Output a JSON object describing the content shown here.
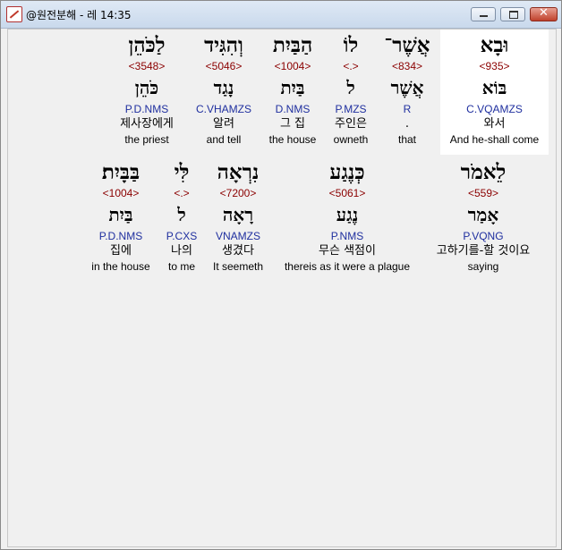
{
  "window": {
    "title": "@원전분해 - 레 14:35",
    "icon": "app-icon",
    "buttons": {
      "minimize": "minimize-icon",
      "maximize": "maximize-icon",
      "close": "✕"
    }
  },
  "colors": {
    "strong": "#8b0000",
    "morph": "#1f2f9f",
    "highlight_bg": "#ffffff"
  },
  "rows": [
    {
      "words": [
        {
          "heb": "וּבָא",
          "strong": "<935>",
          "lemma": "בּוֹא",
          "morph": "C.VQAMZS",
          "kor": "와서",
          "eng": "And he-shall come"
        },
        {
          "heb": "אֲשֶׁר־",
          "strong": "<834>",
          "lemma": "אֲשֶׁר",
          "morph": "R",
          "kor": ".",
          "eng": "that"
        },
        {
          "heb": "לוֹ",
          "strong": "<.>",
          "lemma": "ל",
          "morph": "P.MZS",
          "kor": "주인은",
          "eng": "owneth"
        },
        {
          "heb": "הַבַּיִת",
          "strong": "<1004>",
          "lemma": "בַּיִת",
          "morph": "D.NMS",
          "kor": "그 집",
          "eng": "the house"
        },
        {
          "heb": "וְהִגִּיד",
          "strong": "<5046>",
          "lemma": "נָגַד",
          "morph": "C.VHAMZS",
          "kor": "알려",
          "eng": "and tell"
        },
        {
          "heb": "לַכֹּהֵן",
          "strong": "<3548>",
          "lemma": "כֹּהֵן",
          "morph": "P.D.NMS",
          "kor": "제사장에게",
          "eng": "the priest"
        }
      ]
    },
    {
      "words": [
        {
          "heb": "לֵאמֹר",
          "strong": "<559>",
          "lemma": "אָמַר",
          "morph": "P.VQNG",
          "kor": "고하기를-할 것이요",
          "eng": "saying"
        },
        {
          "heb": "כְּנֶגַע",
          "strong": "<5061>",
          "lemma": "נֶגַע",
          "morph": "P.NMS",
          "kor": "무슨 색점이",
          "eng": "thereis as it were a plague"
        },
        {
          "heb": "נִרְאָה",
          "strong": "<7200>",
          "lemma": "רָאָה",
          "morph": "VNAMZS",
          "kor": "생겼다",
          "eng": "It seemeth"
        },
        {
          "heb": "לִּי",
          "strong": "<.>",
          "lemma": "ל",
          "morph": "P.CXS",
          "kor": "나의",
          "eng": "to me"
        },
        {
          "heb": "בַּבָּיִת׃",
          "strong": "<1004>",
          "lemma": "בַּיִת",
          "morph": "P.D.NMS",
          "kor": "집에",
          "eng": "in the house"
        }
      ]
    }
  ]
}
